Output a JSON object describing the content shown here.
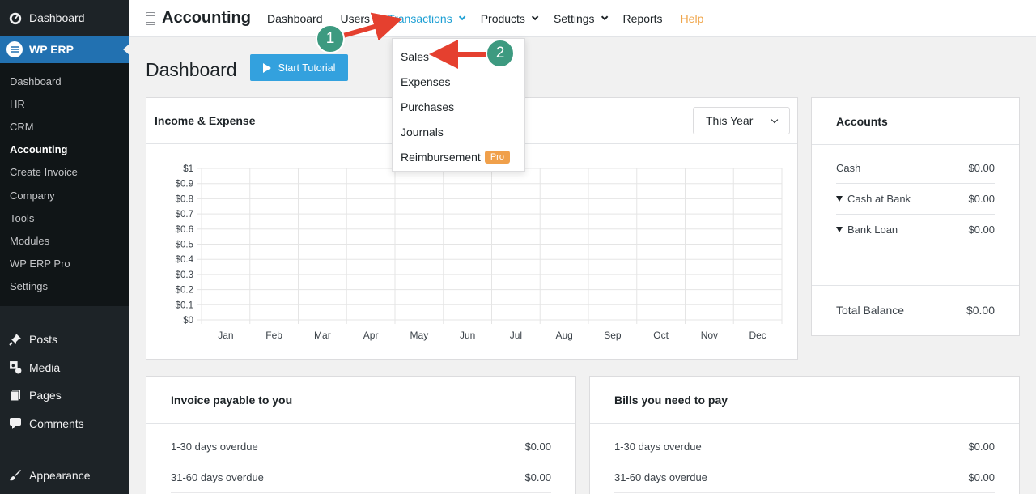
{
  "sidebar": {
    "dashboard_label": "Dashboard",
    "plugin_label": "WP ERP",
    "submenu": [
      "Dashboard",
      "HR",
      "CRM",
      "Accounting",
      "Create Invoice",
      "Company",
      "Tools",
      "Modules",
      "WP ERP Pro",
      "Settings"
    ],
    "current_submenu": "Accounting",
    "items": [
      {
        "label": "Posts",
        "icon": "pin-icon"
      },
      {
        "label": "Media",
        "icon": "media-icon"
      },
      {
        "label": "Pages",
        "icon": "pages-icon"
      },
      {
        "label": "Comments",
        "icon": "comment-icon"
      },
      {
        "label": "Appearance",
        "icon": "brush-icon"
      }
    ]
  },
  "topnav": {
    "brand": "Accounting",
    "items": [
      "Dashboard",
      "Users",
      "Transactions",
      "Products",
      "Settings",
      "Reports",
      "Help"
    ],
    "active": "Transactions"
  },
  "dropdown": {
    "items": [
      "Sales",
      "Expenses",
      "Purchases",
      "Journals",
      "Reimbursement"
    ],
    "badge": "Pro"
  },
  "page": {
    "title": "Dashboard",
    "tutorial_button": "Start Tutorial"
  },
  "income_panel": {
    "title": "Income & Expense",
    "period": "This Year"
  },
  "chart_data": {
    "type": "bar",
    "title": "",
    "categories": [
      "Jan",
      "Feb",
      "Mar",
      "Apr",
      "May",
      "Jun",
      "Jul",
      "Aug",
      "Sep",
      "Oct",
      "Nov",
      "Dec"
    ],
    "y_ticks": [
      "$0",
      "$0.1",
      "$0.2",
      "$0.3",
      "$0.4",
      "$0.5",
      "$0.6",
      "$0.7",
      "$0.8",
      "$0.9",
      "$1"
    ],
    "ylim": [
      0,
      1
    ],
    "grid": true,
    "series": []
  },
  "accounts": {
    "title": "Accounts",
    "rows": [
      {
        "name": "Cash",
        "value": "$0.00",
        "expandable": false
      },
      {
        "name": "Cash at Bank",
        "value": "$0.00",
        "expandable": true
      },
      {
        "name": "Bank Loan",
        "value": "$0.00",
        "expandable": true
      }
    ],
    "total_label": "Total Balance",
    "total_value": "$0.00"
  },
  "invoice_panel": {
    "title": "Invoice payable to you",
    "rows": [
      {
        "label": "1-30 days overdue",
        "value": "$0.00"
      },
      {
        "label": "31-60 days overdue",
        "value": "$0.00"
      }
    ]
  },
  "bills_panel": {
    "title": "Bills you need to pay",
    "rows": [
      {
        "label": "1-30 days overdue",
        "value": "$0.00"
      },
      {
        "label": "31-60 days overdue",
        "value": "$0.00"
      }
    ]
  },
  "annotations": {
    "steps": [
      "1",
      "2"
    ],
    "color": "#3d9a80",
    "arrow_color": "#e5402f"
  }
}
